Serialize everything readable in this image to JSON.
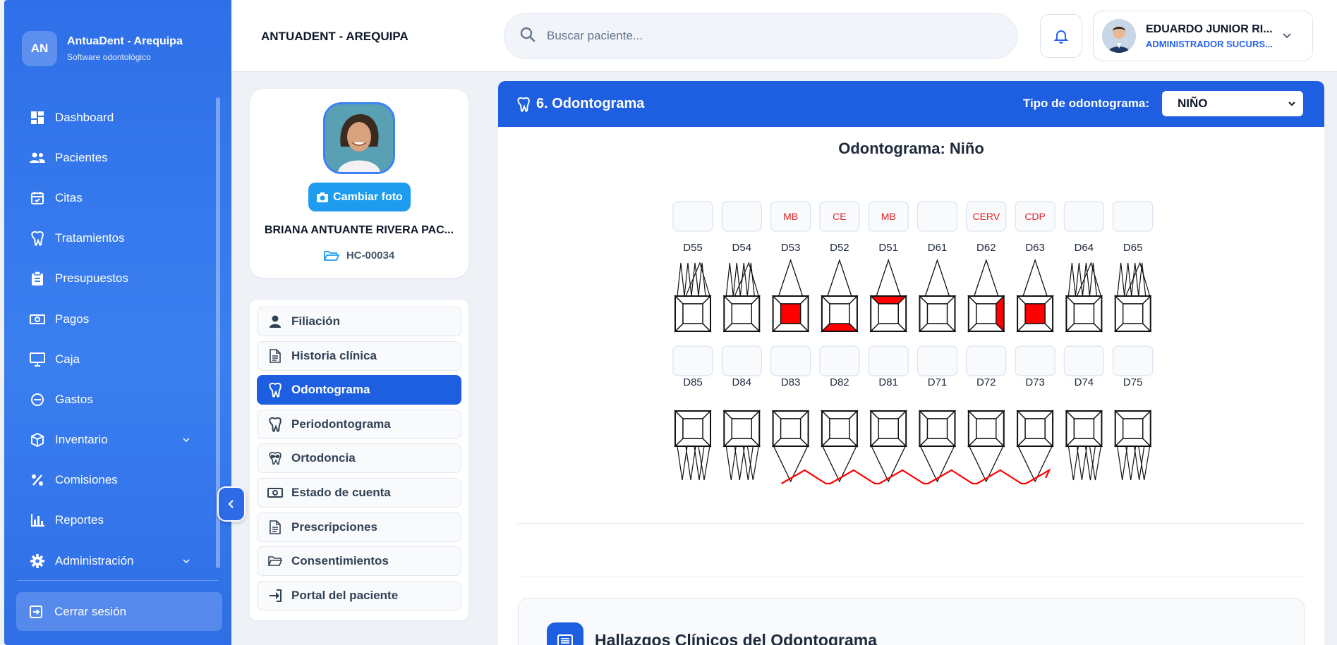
{
  "brand": {
    "initials": "AN",
    "name": "AntuaDent - Arequipa",
    "subtitle": "Software odontológico"
  },
  "sidebar": {
    "items": [
      {
        "label": "Dashboard",
        "icon": "dashboard-icon"
      },
      {
        "label": "Pacientes",
        "icon": "users-icon"
      },
      {
        "label": "Citas",
        "icon": "calendar-icon"
      },
      {
        "label": "Tratamientos",
        "icon": "tooth-icon"
      },
      {
        "label": "Presupuestos",
        "icon": "clipboard-icon"
      },
      {
        "label": "Pagos",
        "icon": "money-icon"
      },
      {
        "label": "Caja",
        "icon": "monitor-icon"
      },
      {
        "label": "Gastos",
        "icon": "minus-circle-icon"
      },
      {
        "label": "Inventario",
        "icon": "box-icon",
        "expandable": true
      },
      {
        "label": "Comisiones",
        "icon": "percent-icon"
      },
      {
        "label": "Reportes",
        "icon": "bar-chart-icon"
      },
      {
        "label": "Administración",
        "icon": "gear-icon",
        "expandable": true
      }
    ],
    "logout": "Cerrar sesión"
  },
  "header": {
    "clinic": "ANTUADENT - AREQUIPA",
    "search_placeholder": "Buscar paciente...",
    "user_name": "EDUARDO JUNIOR RI...",
    "user_role": "ADMINISTRADOR SUCURS..."
  },
  "patient": {
    "change_photo": "Cambiar foto",
    "name": "BRIANA ANTUANTE RIVERA PAC...",
    "hc": "HC-00034"
  },
  "patient_menu": [
    {
      "label": "Filiación",
      "icon": "user-icon",
      "active": false
    },
    {
      "label": "Historia clínica",
      "icon": "document-icon",
      "active": false
    },
    {
      "label": "Odontograma",
      "icon": "tooth-icon",
      "active": true
    },
    {
      "label": "Periodontograma",
      "icon": "tooth-icon",
      "active": false
    },
    {
      "label": "Ortodoncia",
      "icon": "braces-icon",
      "active": false
    },
    {
      "label": "Estado de cuenta",
      "icon": "money-icon",
      "active": false
    },
    {
      "label": "Prescripciones",
      "icon": "document-icon",
      "active": false
    },
    {
      "label": "Consentimientos",
      "icon": "folder-icon",
      "active": false
    },
    {
      "label": "Portal del paciente",
      "icon": "login-icon",
      "active": false
    }
  ],
  "odontogram": {
    "section_title": "6. Odontograma",
    "type_label": "Tipo de odontograma:",
    "type_value": "NIÑO",
    "subtitle": "Odontograma: Niño",
    "upper": [
      {
        "num": "D55",
        "code": "",
        "fill": []
      },
      {
        "num": "D54",
        "code": "",
        "fill": []
      },
      {
        "num": "D53",
        "code": "MB",
        "fill": [
          "center"
        ]
      },
      {
        "num": "D52",
        "code": "CE",
        "fill": [
          "bottom"
        ]
      },
      {
        "num": "D51",
        "code": "MB",
        "fill": [
          "top"
        ]
      },
      {
        "num": "D61",
        "code": "",
        "fill": []
      },
      {
        "num": "D62",
        "code": "CERV",
        "fill": [
          "right"
        ]
      },
      {
        "num": "D63",
        "code": "CDP",
        "fill": [
          "center"
        ]
      },
      {
        "num": "D64",
        "code": "",
        "fill": []
      },
      {
        "num": "D65",
        "code": "",
        "fill": []
      }
    ],
    "lower": [
      {
        "num": "D85",
        "code": "",
        "fill": []
      },
      {
        "num": "D84",
        "code": "",
        "fill": []
      },
      {
        "num": "D83",
        "code": "",
        "fill": []
      },
      {
        "num": "D82",
        "code": "",
        "fill": []
      },
      {
        "num": "D81",
        "code": "",
        "fill": []
      },
      {
        "num": "D71",
        "code": "",
        "fill": []
      },
      {
        "num": "D72",
        "code": "",
        "fill": []
      },
      {
        "num": "D73",
        "code": "",
        "fill": []
      },
      {
        "num": "D74",
        "code": "",
        "fill": []
      },
      {
        "num": "D75",
        "code": "",
        "fill": []
      }
    ],
    "findings_title": "Hallazgos Clínicos del Odontograma",
    "colors": {
      "finding": "#ff0000",
      "accent": "#1d5fe0"
    }
  }
}
